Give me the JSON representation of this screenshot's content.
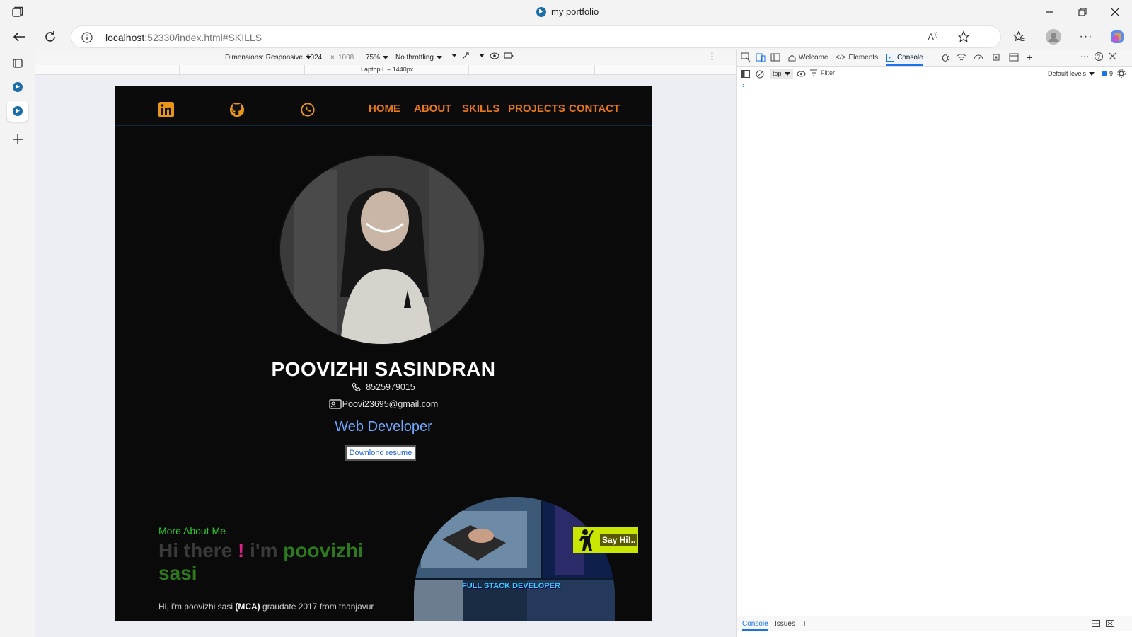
{
  "browser": {
    "window_title": "my portfolio",
    "url_host": "localhost",
    "url_rest": ":52330/index.html#SKILLS"
  },
  "device_toolbar": {
    "dimensions_label": "Dimensions: Responsive",
    "width": "1024",
    "times": "×",
    "height": "1008",
    "zoom": "75%",
    "throttling": "No throttling",
    "ruler_label": "Laptop L – 1440px"
  },
  "site": {
    "nav": [
      "HOME",
      "ABOUT",
      "SKILLS",
      "PROJECTS",
      "CONTACT"
    ],
    "name": "POOVIZHI SASINDRAN",
    "phone": "8525979015",
    "email": "Poovi23695@gmail.com",
    "role": "Web Developer",
    "resume_button": "Downlond resume",
    "more_about": "More About Me",
    "hi_part1": "Hi there ",
    "hi_excl": "!",
    "hi_part2": " i'm ",
    "hi_name": "poovizhi sasi",
    "bio_pre": "Hi, i'm poovizhi sasi ",
    "bio_bold": "(MCA)",
    "bio_post": " graudate 2017 from thanjavur",
    "say_hi": "Say Hi!..",
    "collage_caption": "FULL STACK DEVELOPER"
  },
  "devtools": {
    "tabs": [
      "Welcome",
      "Elements",
      "Console"
    ],
    "active_tab": "Console",
    "context": "top",
    "filter_placeholder": "Filter",
    "levels": "Default levels",
    "issues_count": "9",
    "bottom_tabs": [
      "Console",
      "Issues"
    ]
  },
  "colors": {
    "nav_link": "#e8761a",
    "role": "#6fa8ff",
    "more_about": "#2ccc2c",
    "accent_pink": "#e0208a",
    "accent_green": "#2d7a1e"
  }
}
